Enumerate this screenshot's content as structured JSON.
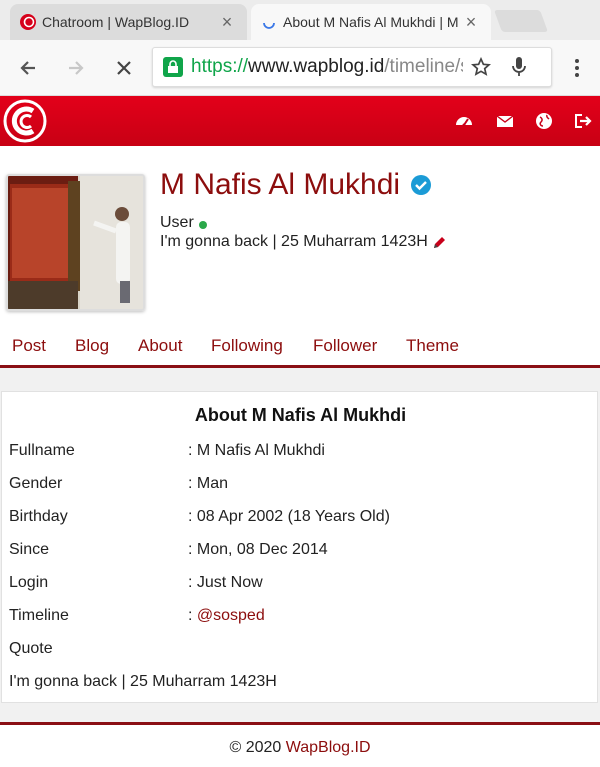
{
  "browser": {
    "tabs": [
      {
        "title": "Chatroom | WapBlog.ID",
        "close": "×",
        "favicon": "wapblog-logo-icon"
      },
      {
        "title": "About M Nafis Al Mukhdi | M",
        "close": "×",
        "favicon": "loading-spinner-icon"
      }
    ],
    "url": {
      "scheme": "https://",
      "host": "www.wapblog.id",
      "path": "/timeline/s"
    }
  },
  "colors": {
    "brand_red": "#d6001a",
    "link": "#8c0d0d",
    "verified": "#1b9bd6",
    "online": "#2aa84a"
  },
  "header_icons": [
    "dashboard-icon",
    "mail-icon",
    "globe-icon",
    "logout-icon"
  ],
  "profile": {
    "name": "M Nafis Al Mukhdi",
    "role": "User",
    "status": "I'm gonna back | 25 Muharram 1423H",
    "nav": [
      "Post",
      "Blog",
      "About",
      "Following",
      "Follower",
      "Theme"
    ]
  },
  "about": {
    "title": "About M Nafis Al Mukhdi",
    "rows": [
      {
        "label": "Fullname",
        "value": ": M Nafis Al Mukhdi"
      },
      {
        "label": "Gender",
        "value": ": Man"
      },
      {
        "label": "Birthday",
        "value": ": 08 Apr 2002 (18 Years Old)"
      },
      {
        "label": "Since",
        "value": ": Mon, 08 Dec 2014"
      },
      {
        "label": "Login",
        "value": ": Just Now"
      }
    ],
    "timeline": {
      "label": "Timeline",
      "prefix": ": ",
      "link": "@sosped"
    },
    "quote_label": "Quote",
    "quote": "I'm gonna back | 25 Muharram 1423H"
  },
  "footer": {
    "copyright": "© 2020 ",
    "site": "WapBlog.ID"
  }
}
